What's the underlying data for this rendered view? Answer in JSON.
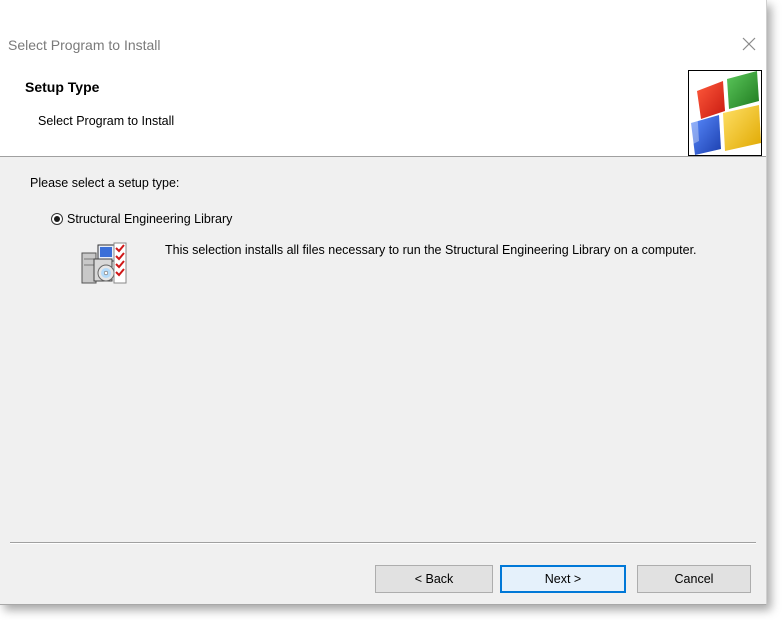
{
  "window": {
    "title": "Select Program to Install"
  },
  "header": {
    "title": "Setup Type",
    "subtitle": "Select Program to Install",
    "logo_icon": "windows-logo-icon"
  },
  "content": {
    "prompt": "Please select a setup type:",
    "options": [
      {
        "label": "Structural Engineering Library",
        "selected": true,
        "description": "This selection installs all files necessary to run the Structural Engineering Library on a computer.",
        "icon": "setup-package-icon"
      }
    ]
  },
  "buttons": {
    "back": "< Back",
    "next": "Next >",
    "cancel": "Cancel"
  },
  "colors": {
    "dialog_background": "#f0f0f0",
    "header_background": "#ffffff",
    "button_background": "#e1e1e1",
    "default_button_border": "#0078d7",
    "logo_red": "#e8281c",
    "logo_green": "#2f9a2f",
    "logo_blue": "#2a5bd7",
    "logo_yellow": "#f5c21a"
  }
}
